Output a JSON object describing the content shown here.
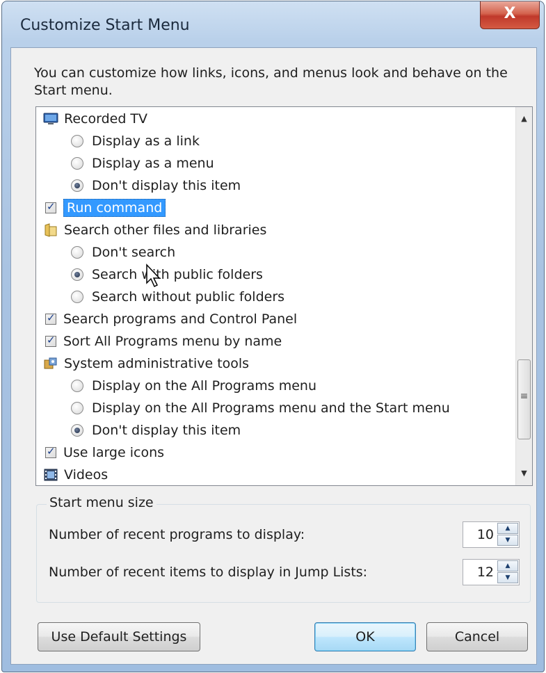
{
  "window": {
    "title": "Customize Start Menu",
    "close_label": "X",
    "description": "You can customize how links, icons, and menus look and behave on the Start menu."
  },
  "list": {
    "items": [
      {
        "label": "Recorded TV",
        "kind": "icon",
        "icon": "tv-icon"
      },
      {
        "label": "Display as a link",
        "kind": "radio",
        "checked": false
      },
      {
        "label": "Display as a menu",
        "kind": "radio",
        "checked": false
      },
      {
        "label": "Don't display this item",
        "kind": "radio",
        "checked": true
      },
      {
        "label": "Run command",
        "kind": "checkbox",
        "checked": true,
        "selected": true
      },
      {
        "label": "Search other files and libraries",
        "kind": "icon",
        "icon": "folder-search-icon"
      },
      {
        "label": "Don't search",
        "kind": "radio",
        "checked": false
      },
      {
        "label": "Search with public folders",
        "kind": "radio",
        "checked": true
      },
      {
        "label": "Search without public folders",
        "kind": "radio",
        "checked": false
      },
      {
        "label": "Search programs and Control Panel",
        "kind": "checkbox",
        "checked": true
      },
      {
        "label": "Sort All Programs menu by name",
        "kind": "checkbox",
        "checked": true
      },
      {
        "label": "System administrative tools",
        "kind": "icon",
        "icon": "admin-tools-icon"
      },
      {
        "label": "Display on the All Programs menu",
        "kind": "radio",
        "checked": false
      },
      {
        "label": "Display on the All Programs menu and the Start menu",
        "kind": "radio",
        "checked": false
      },
      {
        "label": "Don't display this item",
        "kind": "radio",
        "checked": true
      },
      {
        "label": "Use large icons",
        "kind": "checkbox",
        "checked": true
      },
      {
        "label": "Videos",
        "kind": "icon",
        "icon": "videos-icon"
      }
    ]
  },
  "start_menu_size": {
    "legend": "Start menu size",
    "recent_programs_label": "Number of recent programs to display:",
    "recent_programs_value": "10",
    "jump_list_label": "Number of recent items to display in Jump Lists:",
    "jump_list_value": "12"
  },
  "buttons": {
    "default_settings": "Use Default Settings",
    "ok": "OK",
    "cancel": "Cancel"
  }
}
